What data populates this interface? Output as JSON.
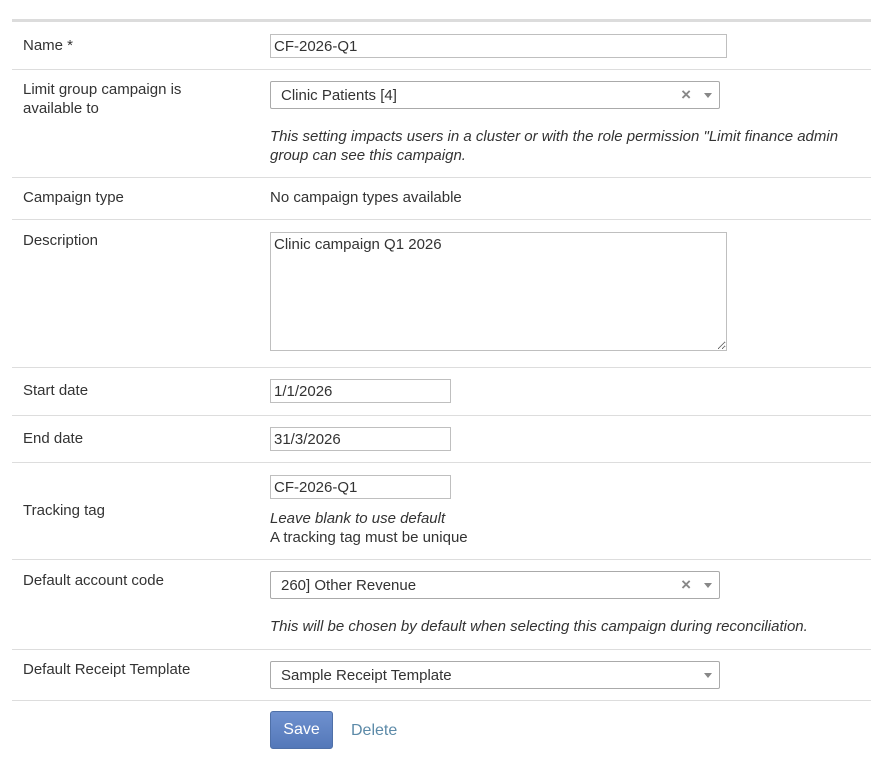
{
  "name": {
    "label": "Name *",
    "value": "CF-2026-Q1"
  },
  "limit_group": {
    "label": "Limit group campaign is available to",
    "selected": "Clinic Patients [4]",
    "clear_glyph": "×",
    "help_line1": "This setting impacts users in a cluster or with the role permission \"Limit finance admin",
    "help_line2": "group can see this campaign."
  },
  "campaign_type": {
    "label": "Campaign type",
    "value": "No campaign types available"
  },
  "description": {
    "label": "Description",
    "value": "Clinic campaign Q1 2026"
  },
  "start_date": {
    "label": "Start date",
    "value": "1/1/2026"
  },
  "end_date": {
    "label": "End date",
    "value": "31/3/2026"
  },
  "tracking_tag": {
    "label": "Tracking tag",
    "value": "CF-2026-Q1",
    "help_italic": "Leave blank to use default",
    "help_plain": "A tracking tag must be unique"
  },
  "account_code": {
    "label": "Default account code",
    "selected": "260] Other Revenue",
    "clear_glyph": "×",
    "help": "This will be chosen by default when selecting this campaign during reconciliation."
  },
  "receipt_template": {
    "label": "Default Receipt Template",
    "selected": "Sample Receipt Template"
  },
  "actions": {
    "save_label": "Save",
    "delete_label": "Delete"
  },
  "colors": {
    "primary_button": "#5f82c2",
    "link": "#5c8aa8",
    "row_border": "#dddddd"
  }
}
